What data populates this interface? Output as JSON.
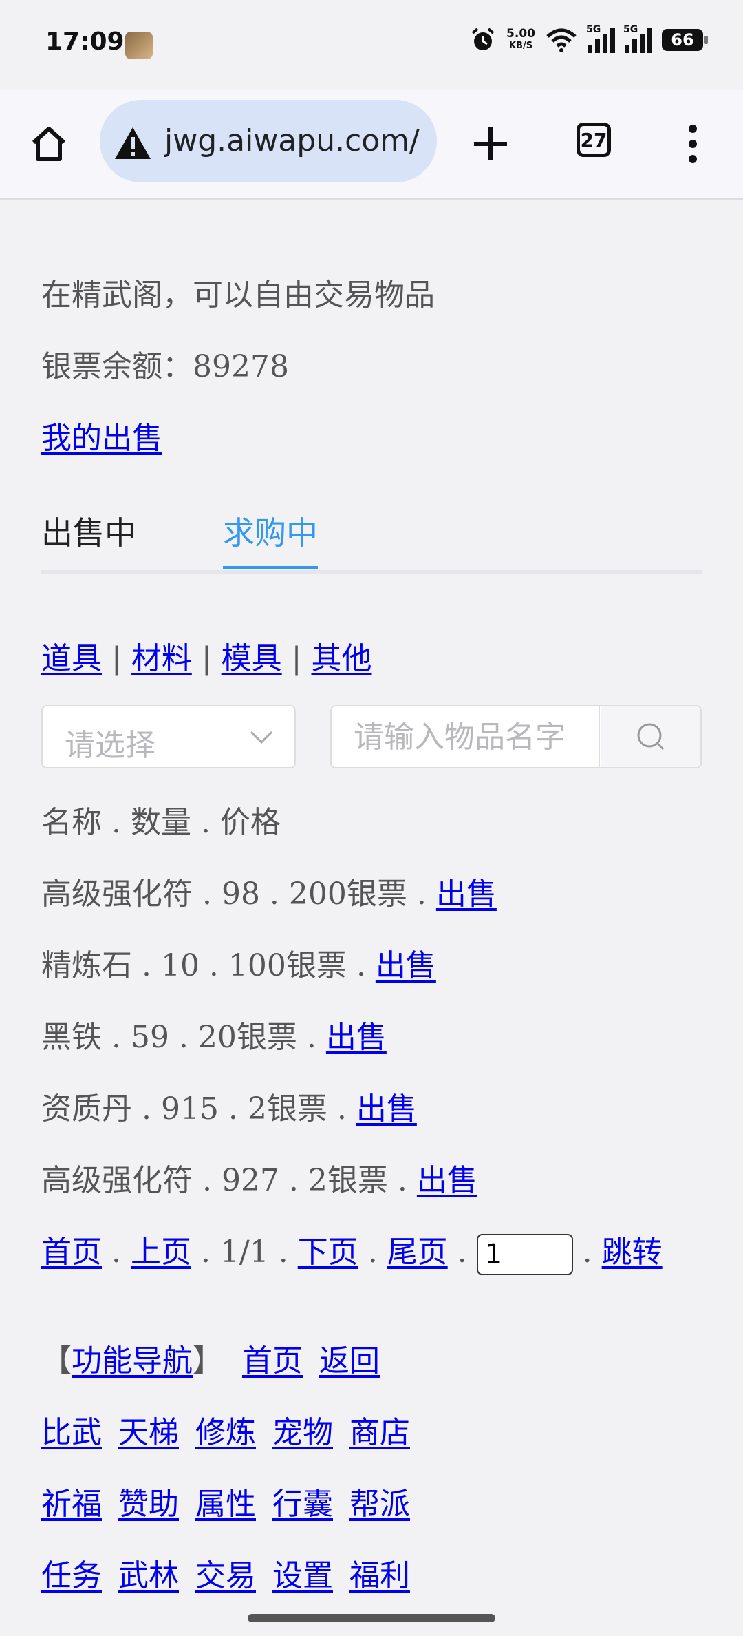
{
  "status": {
    "time": "17:09",
    "net_speed": "5.00",
    "net_unit": "KB/S",
    "sig1": "5G",
    "sig2": "5G",
    "battery": "66"
  },
  "browser": {
    "url": "jwg.aiwapu.com/",
    "tab_count": "27"
  },
  "intro": "在精武阁，可以自由交易物品",
  "balance": {
    "label": "银票余额：",
    "value": "89278"
  },
  "my_sales": "我的出售",
  "tabs": [
    {
      "label": "出售中"
    },
    {
      "label": "求购中"
    }
  ],
  "categories": [
    "道具",
    "材料",
    "模具",
    "其他"
  ],
  "filter": {
    "select_placeholder": "请选择",
    "search_placeholder": "请输入物品名字"
  },
  "list_header": "名称 . 数量 . 价格",
  "items": [
    {
      "text": "高级强化符 . 98 . 200银票 . ",
      "action": "出售"
    },
    {
      "text": "精炼石 . 10 . 100银票 . ",
      "action": "出售"
    },
    {
      "text": "黑铁 . 59 . 20银票 . ",
      "action": "出售"
    },
    {
      "text": "资质丹 . 915 . 2银票 . ",
      "action": "出售"
    },
    {
      "text": "高级强化符 . 927 . 2银票 . ",
      "action": "出售"
    }
  ],
  "pagination": {
    "first": "首页",
    "prev": "上页",
    "info": "1/1",
    "next": "下页",
    "last": "尾页",
    "page_value": "1",
    "jump": "跳转",
    "dot": " . "
  },
  "footer_nav": {
    "bracket_open": "【",
    "title": "功能导航",
    "bracket_close": "】",
    "home": "首页",
    "back": "返回",
    "row1": [
      "比武",
      "天梯",
      "修炼",
      "宠物",
      "商店"
    ],
    "row2": [
      "祈福",
      "赞助",
      "属性",
      "行囊",
      "帮派"
    ],
    "row3": [
      "任务",
      "武林",
      "交易",
      "设置",
      "福利"
    ]
  }
}
